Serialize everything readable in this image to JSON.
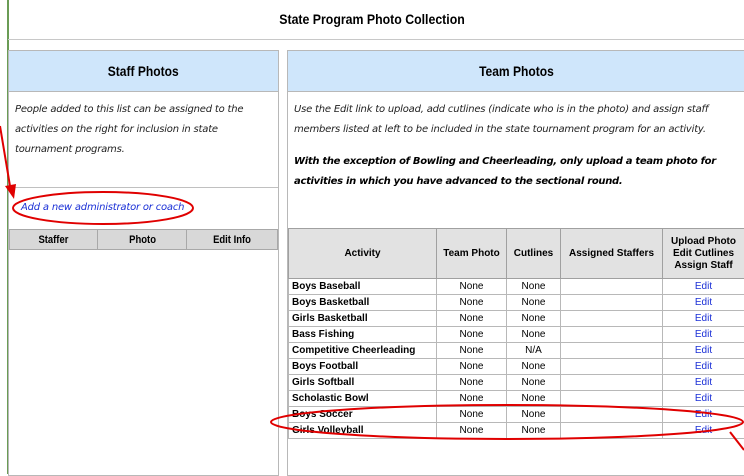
{
  "page_title": "State Program Photo Collection",
  "staff": {
    "heading": "Staff Photos",
    "description": "People added to this list can be assigned to the activities on the right for inclusion in state tournament programs.",
    "add_link": "Add a new administrator or coach",
    "columns": [
      "Staffer",
      "Photo",
      "Edit Info"
    ]
  },
  "team": {
    "heading": "Team Photos",
    "instructions": "Use the Edit link to upload, add cutlines (indicate who is in the photo) and assign staff members listed at left to be included in the state tournament program for an activity.",
    "notice": "With the exception of Bowling and Cheerleading, only upload a team photo for activities in which you have advanced to the sectional round.",
    "columns": {
      "activity": "Activity",
      "team_photo": "Team Photo",
      "cutlines": "Cutlines",
      "assigned": "Assigned Staffers",
      "upload_1": "Upload Photo",
      "upload_2": "Edit Cutlines",
      "upload_3": "Assign Staff"
    },
    "rows": [
      {
        "activity": "Boys Baseball",
        "photo": "None",
        "cutlines": "None",
        "assigned": "",
        "action": "Edit"
      },
      {
        "activity": "Boys Basketball",
        "photo": "None",
        "cutlines": "None",
        "assigned": "",
        "action": "Edit"
      },
      {
        "activity": "Girls Basketball",
        "photo": "None",
        "cutlines": "None",
        "assigned": "",
        "action": "Edit"
      },
      {
        "activity": "Bass Fishing",
        "photo": "None",
        "cutlines": "None",
        "assigned": "",
        "action": "Edit"
      },
      {
        "activity": "Competitive Cheerleading",
        "photo": "None",
        "cutlines": "N/A",
        "assigned": "",
        "action": "Edit"
      },
      {
        "activity": "Boys Football",
        "photo": "None",
        "cutlines": "None",
        "assigned": "",
        "action": "Edit"
      },
      {
        "activity": "Girls Softball",
        "photo": "None",
        "cutlines": "None",
        "assigned": "",
        "action": "Edit"
      },
      {
        "activity": "Scholastic Bowl",
        "photo": "None",
        "cutlines": "None",
        "assigned": "",
        "action": "Edit"
      },
      {
        "activity": "Boys Soccer",
        "photo": "None",
        "cutlines": "None",
        "assigned": "",
        "action": "Edit"
      },
      {
        "activity": "Girls Volleyball",
        "photo": "None",
        "cutlines": "None",
        "assigned": "",
        "action": "Edit"
      }
    ]
  },
  "colors": {
    "panel_header": "#cfe6fb",
    "link": "#1a2fd6",
    "annotation": "#e00000"
  }
}
